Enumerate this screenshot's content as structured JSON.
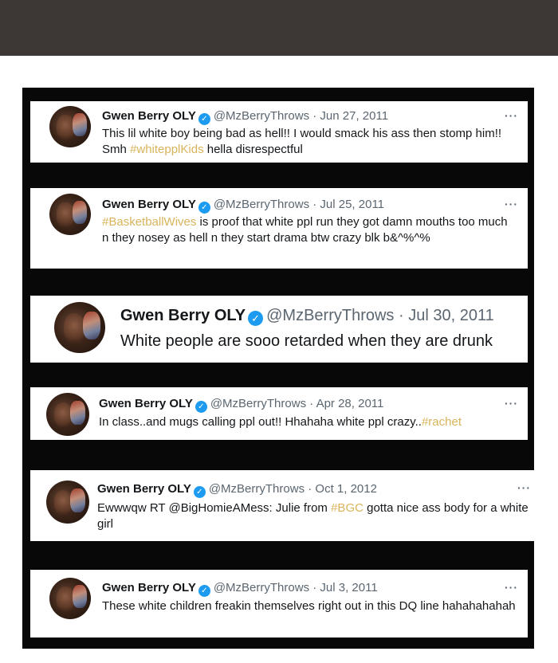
{
  "tweets": [
    {
      "name": "Gwen Berry OLY",
      "handle": "@MzBerryThrows",
      "sep": "·",
      "date": "Jun 27, 2011",
      "more": "···",
      "text_parts": [
        {
          "t": "This lil white boy being bad as hell!! I would smack his ass then stomp him!! Smh ",
          "tag": false
        },
        {
          "t": "#whitepplKids",
          "tag": true
        },
        {
          "t": " hella disrespectful",
          "tag": false
        }
      ]
    },
    {
      "name": "Gwen Berry OLY",
      "handle": "@MzBerryThrows",
      "sep": "·",
      "date": "Jul 25, 2011",
      "more": "···",
      "text_parts": [
        {
          "t": "#BasketballWives",
          "tag": true
        },
        {
          "t": " is proof that white ppl run they got damn mouths too much n they nosey as hell n they start drama btw crazy blk b&^%^%",
          "tag": false
        }
      ]
    },
    {
      "name": "Gwen Berry OLY",
      "handle": "@MzBerryThrows",
      "sep": "·",
      "date": "Jul 30, 2011",
      "more": "",
      "text_parts": [
        {
          "t": "White people are sooo retarded when they are drunk",
          "tag": false
        }
      ]
    },
    {
      "name": "Gwen Berry OLY",
      "handle": "@MzBerryThrows",
      "sep": "·",
      "date": "Apr 28, 2011",
      "more": "···",
      "text_parts": [
        {
          "t": "In class..and mugs calling ppl out!! Hhahaha white ppl crazy..",
          "tag": false
        },
        {
          "t": "#rachet",
          "tag": true
        }
      ]
    },
    {
      "name": "Gwen Berry OLY",
      "handle": "@MzBerryThrows",
      "sep": "·",
      "date": "Oct 1, 2012",
      "more": "···",
      "text_parts": [
        {
          "t": "Ewwwqw RT @BigHomieAMess: Julie from ",
          "tag": false
        },
        {
          "t": "#BGC",
          "tag": true
        },
        {
          "t": " gotta nice ass body for a white girl",
          "tag": false
        }
      ]
    },
    {
      "name": "Gwen Berry OLY",
      "handle": "@MzBerryThrows",
      "sep": "·",
      "date": "Jul 3, 2011",
      "more": "···",
      "text_parts": [
        {
          "t": "These white children freakin themselves right out in this DQ line hahahahahah",
          "tag": false
        }
      ]
    }
  ],
  "verified_icon": "verified-check-icon",
  "colors": {
    "top_bar": "#3d3836",
    "collage_bg": "#080808",
    "hashtag": "#d9b45c",
    "verified": "#1d9bf0",
    "meta_gray": "#5b6670"
  }
}
